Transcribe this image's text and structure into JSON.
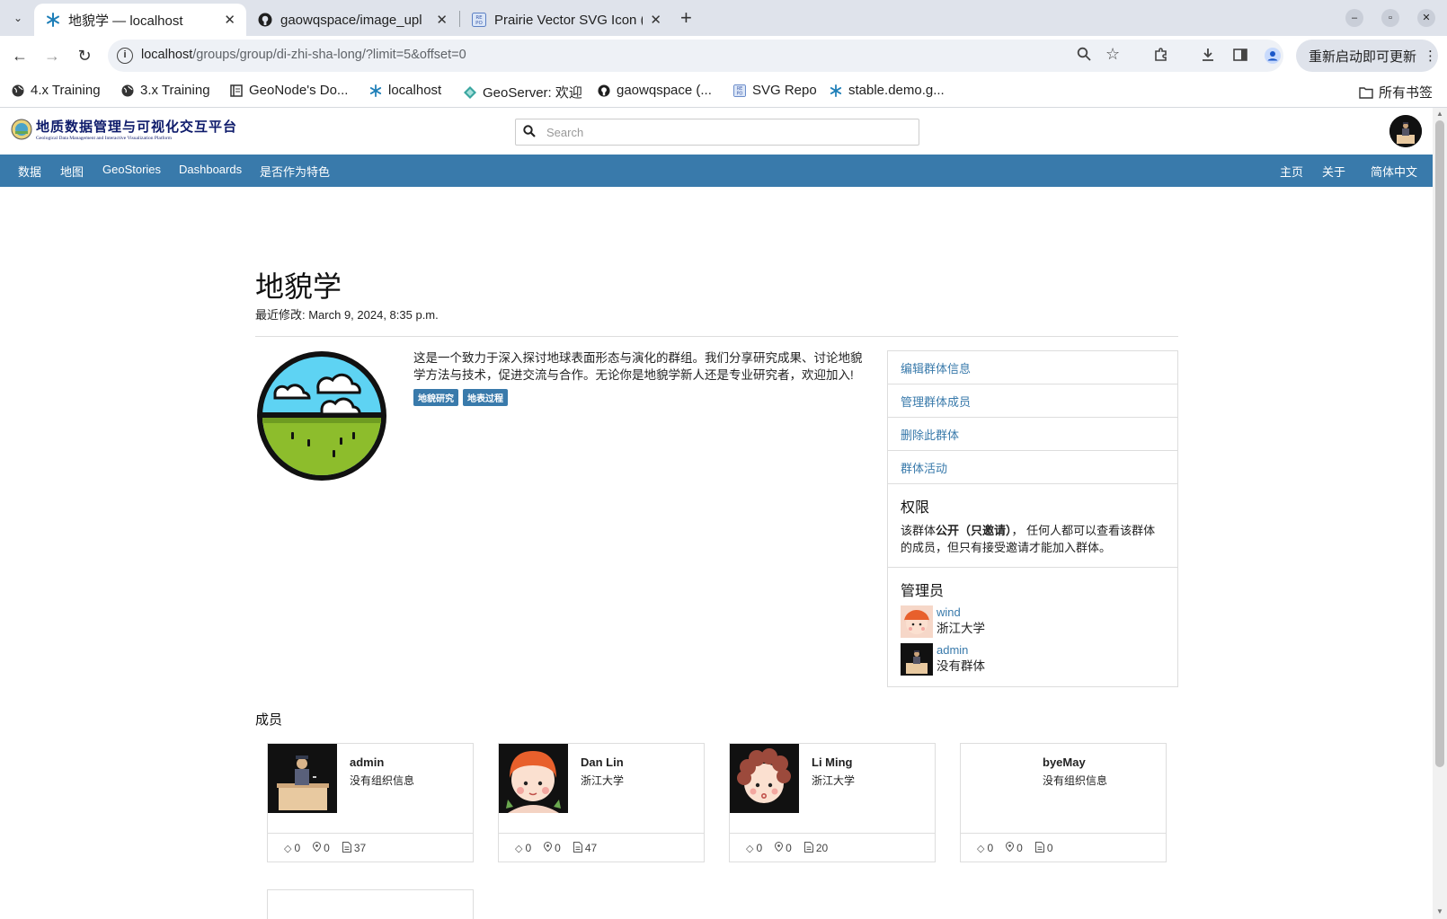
{
  "browser": {
    "tabs": [
      {
        "title": "地貌学 — localhost",
        "icon": "geonode-icon",
        "active": true
      },
      {
        "title": "gaowqspace/image_upl",
        "icon": "github-icon",
        "active": false
      },
      {
        "title": "Prairie Vector SVG Icon (",
        "icon": "svgrepo-icon",
        "active": false
      }
    ],
    "new_tab": "+",
    "url_host": "localhost",
    "url_path": "/groups/group/di-zhi-sha-long/?limit=5&offset=0",
    "update_button": "重新启动即可更新",
    "bookmarks": [
      {
        "label": "4.x Training",
        "icon": "globe-icon"
      },
      {
        "label": "3.x Training",
        "icon": "globe-icon"
      },
      {
        "label": "GeoNode's Do...",
        "icon": "docs-icon"
      },
      {
        "label": "localhost",
        "icon": "geonode-icon"
      },
      {
        "label": "GeoServer: 欢迎",
        "icon": "geoserver-icon"
      },
      {
        "label": "gaowqspace (...",
        "icon": "github-icon"
      },
      {
        "label": "SVG Repo",
        "icon": "svgrepo-icon"
      },
      {
        "label": "stable.demo.g...",
        "icon": "geonode-icon"
      }
    ],
    "all_bookmarks": "所有书签"
  },
  "site": {
    "logo_title": "地质数据管理与可视化交互平台",
    "logo_subtitle": "Geological Data Management and Interactive Visualization Platform",
    "search_placeholder": "Search",
    "nav_left": [
      "数据",
      "地图",
      "GeoStories",
      "Dashboards",
      "是否作为特色"
    ],
    "nav_right": [
      "主页",
      "关于",
      "简体中文"
    ]
  },
  "group": {
    "title": "地貌学",
    "modified": "最近修改: March 9, 2024, 8:35 p.m.",
    "description": "这是一个致力于深入探讨地球表面形态与演化的群组。我们分享研究成果、讨论地貌学方法与技术，促进交流与合作。无论你是地貌学新人还是专业研究者，欢迎加入!",
    "keywords": [
      "地貌研究",
      "地表过程"
    ]
  },
  "sidebar": {
    "links": [
      "编辑群体信息",
      "管理群体成员",
      "删除此群体",
      "群体活动"
    ],
    "permissions_heading": "权限",
    "permissions_prefix": "该群体",
    "permissions_bold": "公开（只邀请）",
    "permissions_suffix": "， 任何人都可以查看该群体的成员，但只有接受邀请才能加入群体。",
    "managers_heading": "管理员",
    "managers": [
      {
        "name": "wind",
        "org": "浙江大学",
        "avatar": "redhead-avatar"
      },
      {
        "name": "admin",
        "org": "没有群体",
        "avatar": "desk-avatar"
      }
    ]
  },
  "members": {
    "heading": "成员",
    "cards": [
      {
        "name": "admin",
        "org": "没有组织信息",
        "layers": "0",
        "maps": "0",
        "docs": "37",
        "avatar": "desk-avatar"
      },
      {
        "name": "Dan Lin",
        "org": "浙江大学",
        "layers": "0",
        "maps": "0",
        "docs": "47",
        "avatar": "redhead-avatar"
      },
      {
        "name": "Li Ming",
        "org": "浙江大学",
        "layers": "0",
        "maps": "0",
        "docs": "20",
        "avatar": "curly-avatar"
      },
      {
        "name": "byeMay",
        "org": "没有组织信息",
        "layers": "0",
        "maps": "0",
        "docs": "0",
        "avatar": "none"
      }
    ]
  },
  "colors": {
    "brand_blue": "#397aab",
    "logo_navy": "#0e1b6b"
  }
}
